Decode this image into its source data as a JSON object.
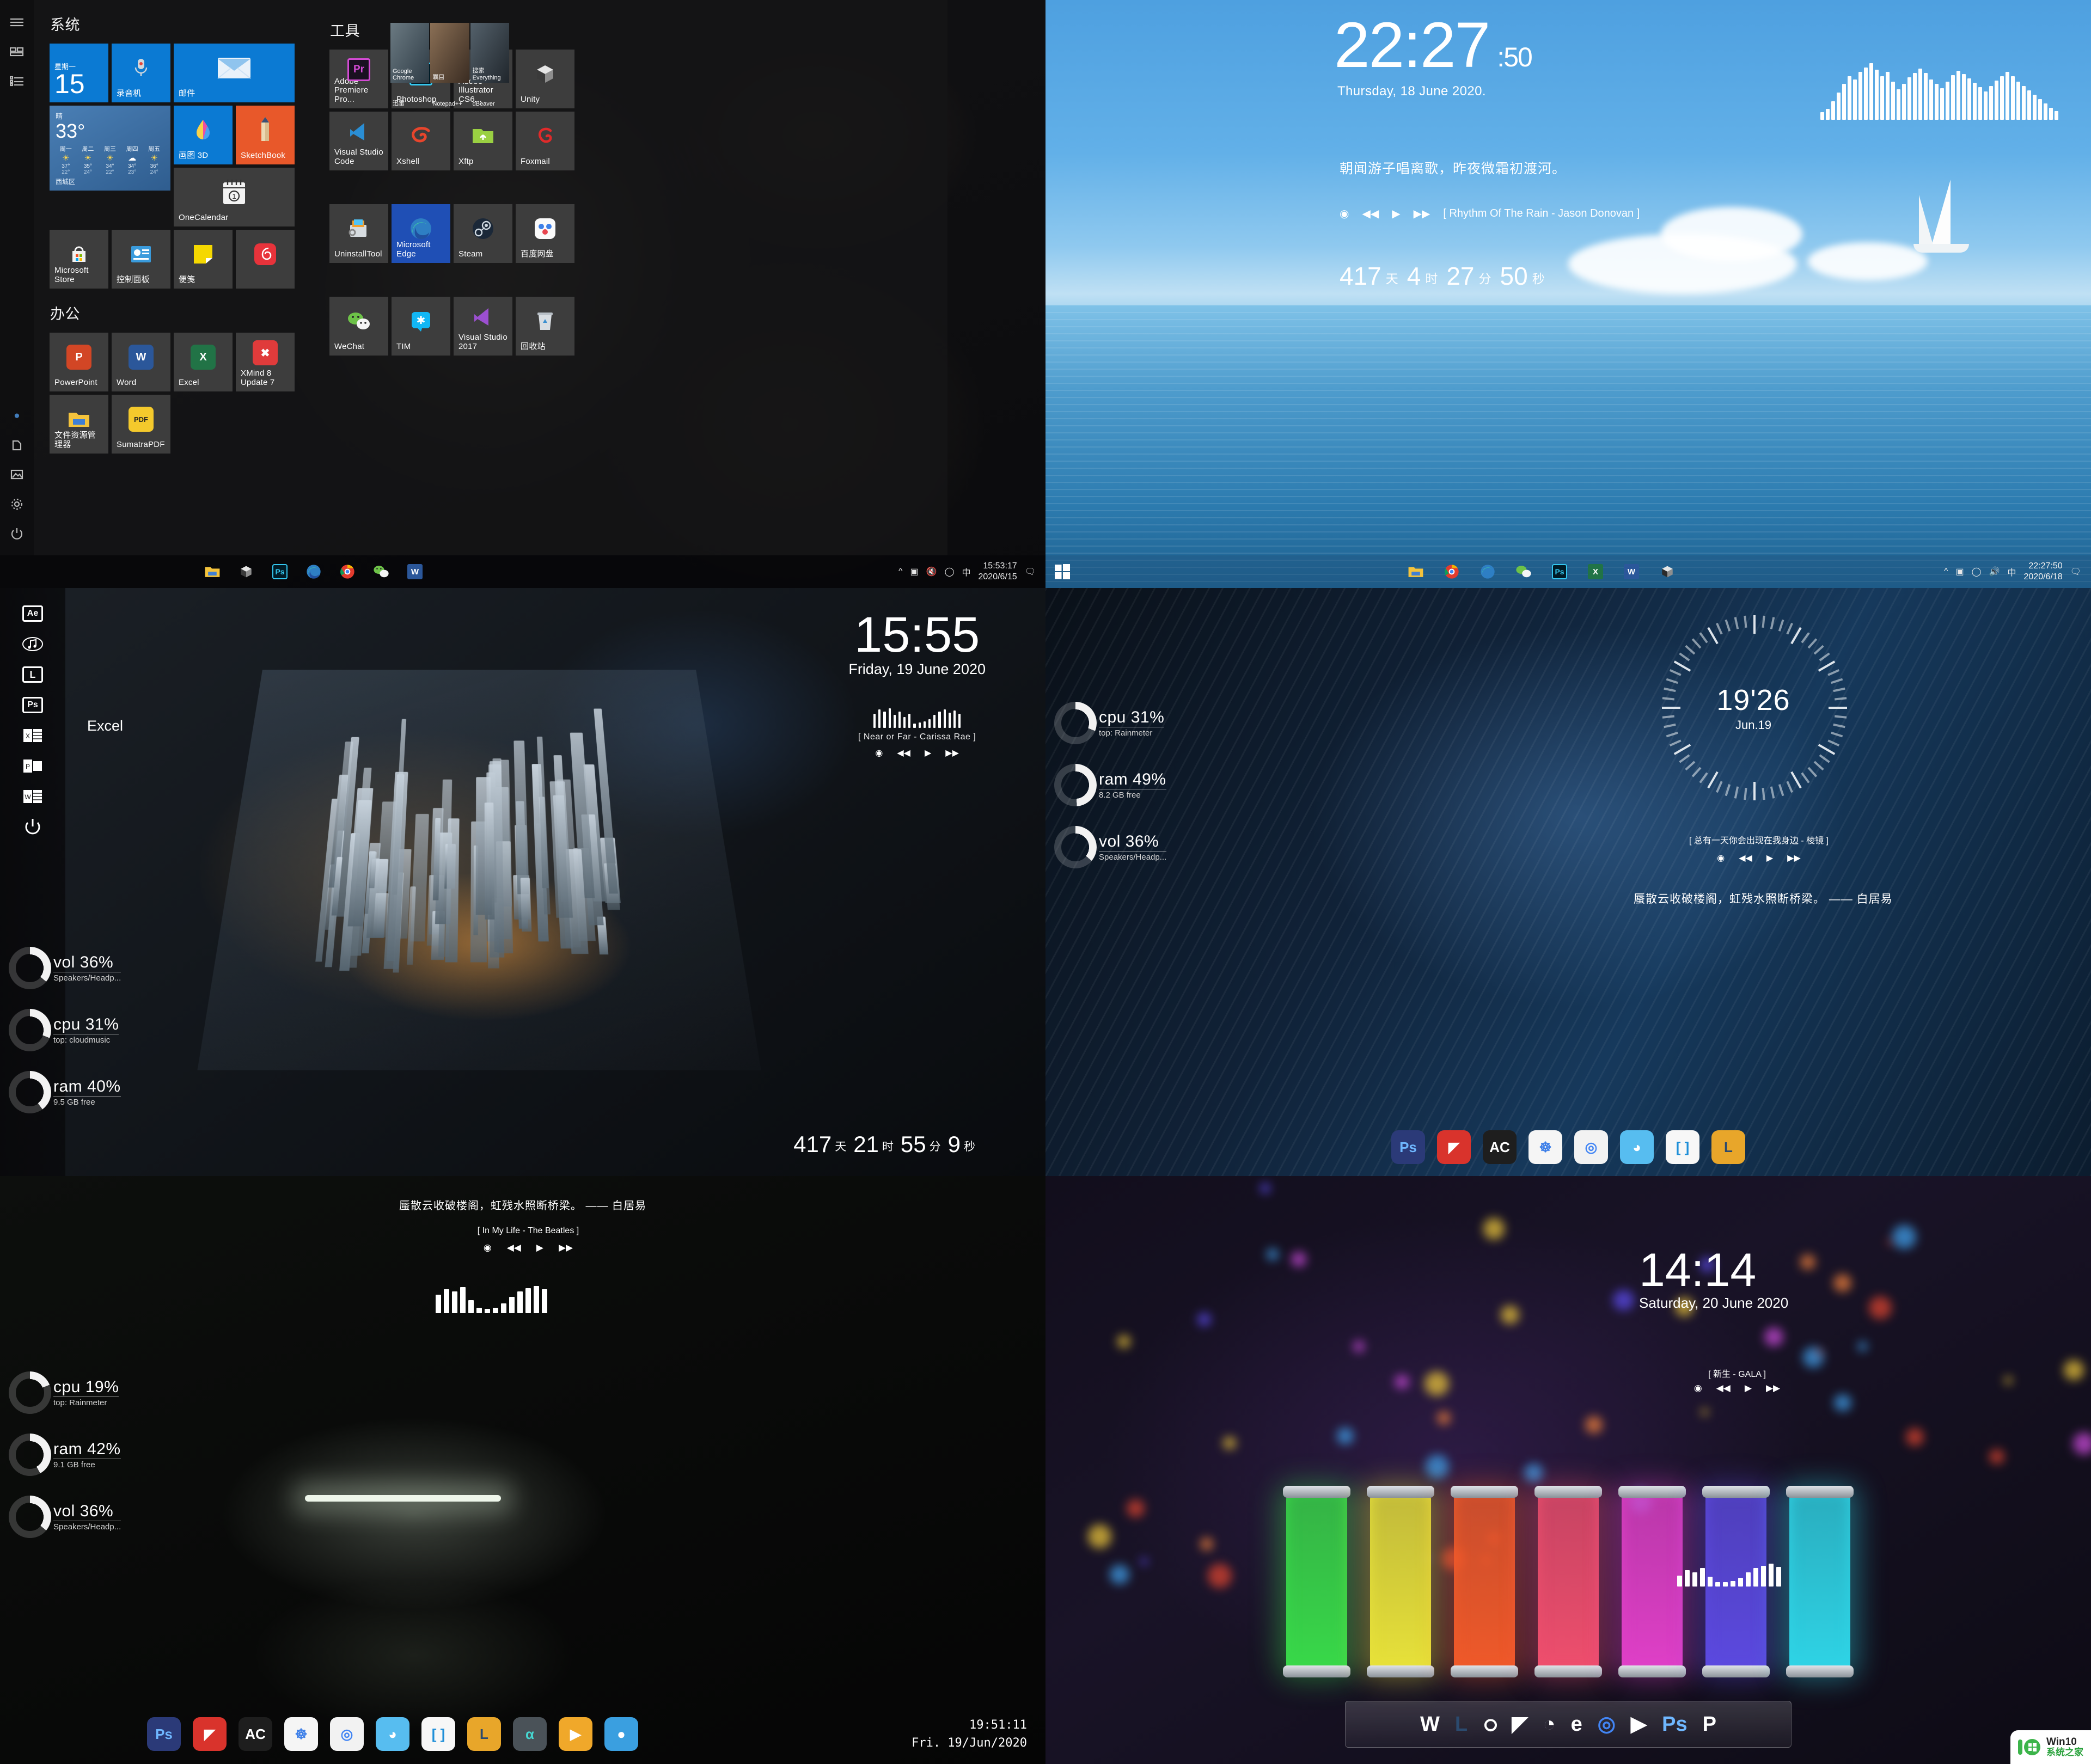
{
  "panels": {
    "start_menu": {
      "rail_icons": [
        "hamburger-menu-icon",
        "tiles-view-icon",
        "all-apps-list-icon",
        "user-account-icon",
        "documents-icon",
        "pictures-icon",
        "settings-gear-icon",
        "power-icon"
      ],
      "groups": [
        {
          "title": "系统",
          "tiles": [
            {
              "label": "星期一",
              "sub": "15",
              "kind": "calendar",
              "color": "#0b7ad3"
            },
            {
              "label": "录音机",
              "kind": "app",
              "color": "#0b7ad3",
              "icon": "microphone-icon"
            },
            {
              "label": "邮件",
              "kind": "wide",
              "color": "#0b7ad3",
              "icon": "mail-icon"
            },
            {
              "label": "画图 3D",
              "kind": "app",
              "color": "#0b7ad3",
              "icon": "paint3d-icon"
            },
            {
              "label": "SketchBook",
              "kind": "app",
              "color": "#e8582a",
              "icon": "pencil-icon"
            },
            {
              "label": "OneCalendar",
              "kind": "wide",
              "color": "#3d3d3d",
              "icon": "calendar-icon"
            },
            {
              "label": "Microsoft Store",
              "kind": "app",
              "color": "#3d3d3d",
              "icon": "store-icon"
            },
            {
              "label": "控制面板",
              "kind": "app",
              "color": "#3d3d3d",
              "icon": "control-panel-icon"
            },
            {
              "label": "便笺",
              "kind": "app",
              "color": "#3d3d3d",
              "icon": "sticky-notes-icon"
            },
            {
              "label": "",
              "kind": "app",
              "color": "#3d3d3d",
              "icon": "netease-music-icon"
            }
          ]
        },
        {
          "title": "办公",
          "tiles": [
            {
              "label": "PowerPoint",
              "kind": "app",
              "color": "#3d3d3d",
              "icon": "powerpoint-icon"
            },
            {
              "label": "Word",
              "kind": "app",
              "color": "#3d3d3d",
              "icon": "word-icon"
            },
            {
              "label": "Excel",
              "kind": "app",
              "color": "#3d3d3d",
              "icon": "excel-icon"
            },
            {
              "label": "XMind 8 Update 7",
              "kind": "app",
              "color": "#3d3d3d",
              "icon": "xmind-icon"
            },
            {
              "label": "文件资源管理器",
              "kind": "app",
              "color": "#3d3d3d",
              "icon": "file-explorer-icon"
            },
            {
              "label": "SumatraPDF",
              "kind": "app",
              "color": "#3d3d3d",
              "icon": "pdf-icon"
            }
          ]
        },
        {
          "title": "工具",
          "tiles": [
            {
              "label": "Adobe Premiere Pro...",
              "kind": "app",
              "color": "#3d3d3d",
              "icon": "premiere-icon"
            },
            {
              "label": "Photoshop",
              "kind": "app",
              "color": "#3d3d3d",
              "icon": "photoshop-icon"
            },
            {
              "label": "Adobe Illustrator CS6...",
              "kind": "app",
              "color": "#3d3d3d",
              "icon": "illustrator-icon"
            },
            {
              "label": "Unity",
              "kind": "app",
              "color": "#3d3d3d",
              "icon": "unity-icon"
            },
            {
              "label": "Visual Studio Code",
              "kind": "app",
              "color": "#3d3d3d",
              "icon": "vscode-icon"
            },
            {
              "label": "Xshell",
              "kind": "app",
              "color": "#3d3d3d",
              "icon": "xshell-icon"
            },
            {
              "label": "Xftp",
              "kind": "app",
              "color": "#3d3d3d",
              "icon": "xftp-icon"
            },
            {
              "label": "Foxmail",
              "kind": "app",
              "color": "#3d3d3d",
              "icon": "foxmail-icon"
            },
            {
              "label": "UninstallTool",
              "kind": "app",
              "color": "#3d3d3d",
              "icon": "uninstall-tool-icon"
            },
            {
              "label": "Microsoft Edge",
              "kind": "app",
              "color": "#1f4fb5",
              "icon": "edge-icon"
            },
            {
              "label": "Steam",
              "kind": "app",
              "color": "#3d3d3d",
              "icon": "steam-icon"
            },
            {
              "label": "百度网盘",
              "kind": "app",
              "color": "#3d3d3d",
              "icon": "baidu-netdisk-icon"
            },
            {
              "label": "WeChat",
              "kind": "app",
              "color": "#3d3d3d",
              "icon": "wechat-icon"
            },
            {
              "label": "TIM",
              "kind": "app",
              "color": "#3d3d3d",
              "icon": "tim-icon"
            },
            {
              "label": "Visual Studio 2017",
              "kind": "app",
              "color": "#3d3d3d",
              "icon": "visual-studio-icon"
            },
            {
              "label": "回收站",
              "kind": "app",
              "color": "#3d3d3d",
              "icon": "recycle-bin-icon"
            }
          ]
        }
      ],
      "pictures": [
        "Google Chrome",
        "瞩目",
        "搜索 Everything",
        "迅雷",
        "Notepad++",
        "dBeaver"
      ],
      "weather": {
        "condition": "晴",
        "temp": "33°",
        "location": "西城区",
        "days": [
          "周一",
          "周二",
          "周三",
          "周四",
          "周五"
        ],
        "icons": [
          "sun",
          "sun",
          "sun",
          "cloud",
          "sun"
        ],
        "highs": [
          "37°",
          "35°",
          "34°",
          "34°",
          "36°"
        ],
        "lows": [
          "22°",
          "24°",
          "22°",
          "23°",
          "24°"
        ]
      },
      "taskbar": {
        "icons": [
          "file-explorer-icon",
          "unity-icon",
          "photoshop-icon",
          "edge-icon",
          "chrome-icon",
          "wechat-icon",
          "word-icon"
        ],
        "tray": [
          "chevron-up-icon",
          "display-icon",
          "volume-muted-icon",
          "wifi-icon"
        ],
        "ime": "中",
        "time": "15:53:17",
        "date": "2020/6/15"
      }
    },
    "sky_desktop": {
      "time": "22:27",
      "seconds": ":50",
      "date": "Thursday, 18 June 2020.",
      "quote": "朝闻游子唱离歌，昨夜微霜初渡河。",
      "track": "[ Rhythm Of The Rain - Jason Donovan ]",
      "player_buttons": [
        "netease-icon",
        "prev-icon",
        "play-icon",
        "next-icon"
      ],
      "countdown": {
        "days": "417",
        "days_unit": "天",
        "hours": "4",
        "hours_unit": "时",
        "minutes": "27",
        "minutes_unit": "分",
        "seconds": "50",
        "seconds_unit": "秒"
      },
      "taskbar": {
        "start": "windows-start-icon",
        "icons": [
          "file-explorer-icon",
          "chrome-icon",
          "edge-icon",
          "wechat-icon",
          "photoshop-icon",
          "excel-icon",
          "word-icon",
          "unity-icon"
        ],
        "tray": [
          "chevron-up-icon",
          "display-icon",
          "wifi-icon",
          "volume-icon"
        ],
        "ime": "中",
        "time": "22:27:50",
        "date": "2020/6/18"
      }
    },
    "circuit_desktop": {
      "time": "15:55",
      "date": "Friday, 19 June 2020",
      "track": "[  Near or Far - Carissa Rae  ]",
      "player_buttons": [
        "netease-icon",
        "prev-icon",
        "play-icon",
        "next-icon"
      ],
      "countdown": {
        "days": "417",
        "days_unit": "天",
        "hours": "21",
        "hours_unit": "时",
        "minutes": "55",
        "minutes_unit": "分",
        "seconds": "9",
        "seconds_unit": "秒"
      },
      "sidebar_icons": [
        "after-effects-icon",
        "music-icon",
        "lightroom-icon",
        "photoshop-icon",
        "excel-icon",
        "powerpoint-icon",
        "word-icon",
        "power-icon"
      ],
      "sidebar_hover_label": "Excel",
      "gauges": [
        {
          "name": "vol",
          "value": "vol 36%",
          "pct": 36,
          "sub": "Speakers/Headp..."
        },
        {
          "name": "cpu",
          "value": "cpu 31%",
          "pct": 31,
          "sub": "top: cloudmusic"
        },
        {
          "name": "ram",
          "value": "ram 40%",
          "pct": 40,
          "sub": "9.5 GB free"
        }
      ]
    },
    "ocean_desktop": {
      "time": "19'26",
      "date": "Jun.19",
      "track": "[ 总有一天你会出现在我身边 - 棱镜 ]",
      "player_buttons": [
        "netease-icon",
        "prev-icon",
        "play-icon",
        "next-icon"
      ],
      "quote": "蜃散云收破楼阁，虹残水照断桥梁。 —— 白居易",
      "gauges": [
        {
          "name": "cpu",
          "value": "cpu 31%",
          "pct": 31,
          "sub": "top: Rainmeter"
        },
        {
          "name": "ram",
          "value": "ram 49%",
          "pct": 49,
          "sub": "8.2 GB free"
        },
        {
          "name": "vol",
          "value": "vol 36%",
          "pct": 36,
          "sub": "Speakers/Headp..."
        }
      ],
      "dock": [
        "photoshop-icon",
        "autocad-icon",
        "appcode-icon",
        "baidu-netdisk-icon",
        "chrome-icon",
        "qq-icon",
        "brackets-icon",
        "lightroom-icon"
      ]
    },
    "darkroom_desktop": {
      "quote": "蜃散云收破楼阁，虹残水照断桥梁。 —— 白居易",
      "track": "[  In My Life - The Beatles  ]",
      "player_buttons": [
        "netease-icon",
        "prev-icon",
        "play-icon",
        "next-icon"
      ],
      "gauges": [
        {
          "name": "cpu",
          "value": "cpu 19%",
          "pct": 19,
          "sub": "top: Rainmeter"
        },
        {
          "name": "ram",
          "value": "ram 42%",
          "pct": 42,
          "sub": "9.1 GB free"
        },
        {
          "name": "vol",
          "value": "vol 36%",
          "pct": 36,
          "sub": "Speakers/Headp..."
        }
      ],
      "dock": [
        "photoshop-icon",
        "autocad-icon",
        "appcode-icon",
        "baidu-netdisk-icon",
        "chrome-icon",
        "qq-icon",
        "brackets-icon",
        "lightroom-icon",
        "alpha-icon",
        "potplayer-icon",
        "tux-icon"
      ],
      "clock_time": "19:51:11",
      "clock_date": "Fri.  19/Jun/2020"
    },
    "neon_desktop": {
      "time": "14:14",
      "date": "Saturday, 20 June 2020",
      "track": "[ 新生 - GALA ]",
      "player_buttons": [
        "netease-icon",
        "prev-icon",
        "play-icon",
        "next-icon"
      ],
      "dock": [
        "word-icon",
        "lightroom-icon",
        "netease-icon",
        "autocad-icon",
        "adobe-icon",
        "edge-icon",
        "chrome-icon",
        "potplayer-icon",
        "photoshop-icon",
        "powerpoint-icon"
      ],
      "tube_colors": [
        "#39d94a",
        "#e8e23a",
        "#f05a2a",
        "#ef4f6e",
        "#e040c8",
        "#5c4ae0",
        "#2fd4e6"
      ]
    },
    "watermark": {
      "line1": "Win10",
      "line2": "系统之家",
      "logo": "win10-home-logo"
    }
  }
}
